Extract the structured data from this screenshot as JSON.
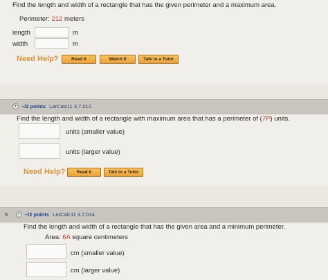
{
  "q1": {
    "text": "Find the length and width of a rectangle that has the given perimeter and a maximum area.",
    "given_label": "Perimeter: ",
    "given_value": "212",
    "given_unit": " meters",
    "fields": [
      {
        "label": "length",
        "unit": "m",
        "value": ""
      },
      {
        "label": "width",
        "unit": "m",
        "value": ""
      }
    ],
    "help": "Need Help?",
    "buttons": [
      "Read It",
      "Watch It",
      "Talk to a Tutor"
    ]
  },
  "q2": {
    "points": "–/2 points",
    "ref": "LarCalc11 3.7.012.",
    "text_before": "Find the length and width of a rectangle with maximum area that has a perimeter of (",
    "text_var": "7P",
    "text_after": ") units.",
    "fields": [
      {
        "unit": "units (smaller value)",
        "value": ""
      },
      {
        "unit": "units (larger value)",
        "value": ""
      }
    ],
    "help": "Need Help?",
    "buttons": [
      "Read It",
      "Talk to a Tutor"
    ]
  },
  "q3": {
    "number": "5.",
    "points": "–/2 points",
    "ref": "LarCalc11 3.7.014.",
    "text": "Find the length and width of a rectangle that has the given area and a minimum perimeter.",
    "given_label": "Area: ",
    "given_value": "6A",
    "given_unit": " square centimeters",
    "fields": [
      {
        "unit": "cm (smaller value)",
        "value": ""
      },
      {
        "unit": "cm (larger value)",
        "value": ""
      }
    ]
  },
  "colors": {
    "accent": "#d9923a",
    "highlight": "#c6402f",
    "button": "#f0b04a"
  }
}
